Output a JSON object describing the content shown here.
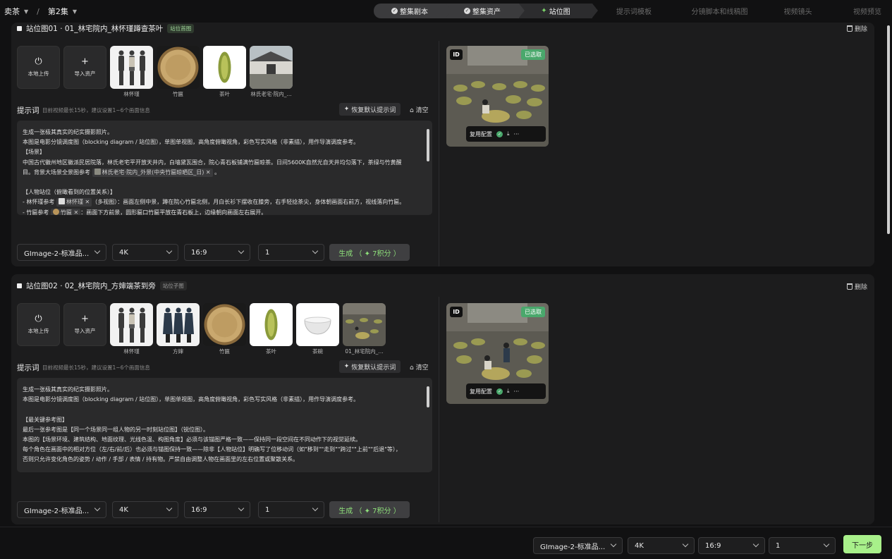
{
  "breadcrumb": {
    "project": "卖茶",
    "episode": "第2集",
    "separator": "/"
  },
  "steps": [
    {
      "label": "整集剧本",
      "state": "done"
    },
    {
      "label": "整集资产",
      "state": "done"
    },
    {
      "label": "站位图",
      "state": "current"
    },
    {
      "label": "提示词模板",
      "state": "todo"
    },
    {
      "label": "分镜脚本和线稿图",
      "state": "todo"
    },
    {
      "label": "视频镜头",
      "state": "todo"
    },
    {
      "label": "视频预览",
      "state": "todo"
    }
  ],
  "common": {
    "upload": "本地上传",
    "import": "导入资产",
    "prompt_label": "提示词",
    "prompt_hint": "目前视频最长15秒，建议设置1~6个画面信息",
    "restore": "恢复默认提示词",
    "clear": "清空",
    "delete": "删除",
    "id_badge": "ID",
    "selected_badge": "已选取",
    "reuse": "复用配置",
    "more": "···"
  },
  "panels": [
    {
      "title": "站位图01 · 01_林宅院内_林怀瑾蹲查茶叶",
      "tag": "站位首图",
      "assets": [
        {
          "label": "林怀瑾",
          "kind": "person1"
        },
        {
          "label": "竹匾",
          "kind": "basket"
        },
        {
          "label": "茶叶",
          "kind": "tea"
        },
        {
          "label": "林氏老宅·院内_...",
          "kind": "house"
        }
      ],
      "prompt": [
        "生成一张极其真实的纪实摄影照片。",
        "本图是电影分镜调度图（blocking diagram / 站位图），单图单视图，高角度俯瞰视角，彩色写实风格（非素描），用作导演调度参考。",
        "【场景】",
        "中国古代徽州地区徽派民居院落，林氏老宅平开放天井内，白墙黛瓦围合，院心青石板铺满竹匾晾茶。日间5600K自然光自天井均匀落下，茶绿与竹黄醒",
        "目。背景大场景全景图参考",
        "",
        "【人物站位（俯瞰看到的位置关系）】",
        "- 林怀瑾参考",
        "- 竹匾参考"
      ],
      "chips": {
        "scene": "林氏老宅·院内_外景(中央竹匾晾晒区_日)",
        "person": "林怀瑾",
        "person_desc": "（多视图）：画面左侧中景，蹲在院心竹匾北侧，月白长衫下摆收在膝旁，右手轻捻茶尖，身体朝画面右前方，视线落向竹匾。",
        "basket": "竹匾",
        "basket_desc": "：画面下方前景，圆形匾口竹匾平放在青石板上，边缘朝向画面左右展开。"
      },
      "settings": {
        "model": "GImage-2-标准品...",
        "resolution": "4K",
        "ratio": "16:9",
        "count": "1",
        "generate": "生成 （ ✦ 7积分 ）"
      }
    },
    {
      "title": "站位图02 · 02_林宅院内_方婶端茶到旁",
      "tag": "站位子图",
      "assets": [
        {
          "label": "林怀瑾",
          "kind": "person1"
        },
        {
          "label": "方婶",
          "kind": "person2"
        },
        {
          "label": "竹匾",
          "kind": "basket"
        },
        {
          "label": "茶叶",
          "kind": "tea"
        },
        {
          "label": "茶碗",
          "kind": "bowl"
        },
        {
          "label": "01_林宅院内_...",
          "kind": "scene"
        }
      ],
      "prompt": [
        "生成一张极其真实的纪实摄影照片。",
        "本图是电影分镜调度图（blocking diagram / 站位图），单图单视图，高角度俯瞰视角，彩色写实风格（非素描），用作导演调度参考。",
        "",
        "【最关键参考图】",
        "最后一张参考图是【同一个场景同一组人物的另一时刻站位图】（锐位图）。",
        "本图的【场景环境、建筑结构、地面纹理、光线色温、构图角度】必须与该锚图严格一致——保持同一段空间在不同动作下的视觉延续。",
        "每个角色在画面中的相对方位（左/右/前/后）也必须与锚图保持一致——除非【人物站位】明确写了位移动词（如\"移到\"\"走到\"\"跨过\"\"上前\"\"后退\"等），",
        "否则只允许变化角色的姿势 / 动作 / 手部 / 表情 / 持有物。严禁自由调整人物在画面里的左右位置或聚散关系。"
      ],
      "settings": {
        "model": "GImage-2-标准品...",
        "resolution": "4K",
        "ratio": "16:9",
        "count": "1",
        "generate": "生成 （ ✦ 7积分 ）"
      }
    }
  ],
  "footer": {
    "model": "GImage-2-标准品...",
    "resolution": "4K",
    "ratio": "16:9",
    "count": "1",
    "next": "下一步"
  }
}
